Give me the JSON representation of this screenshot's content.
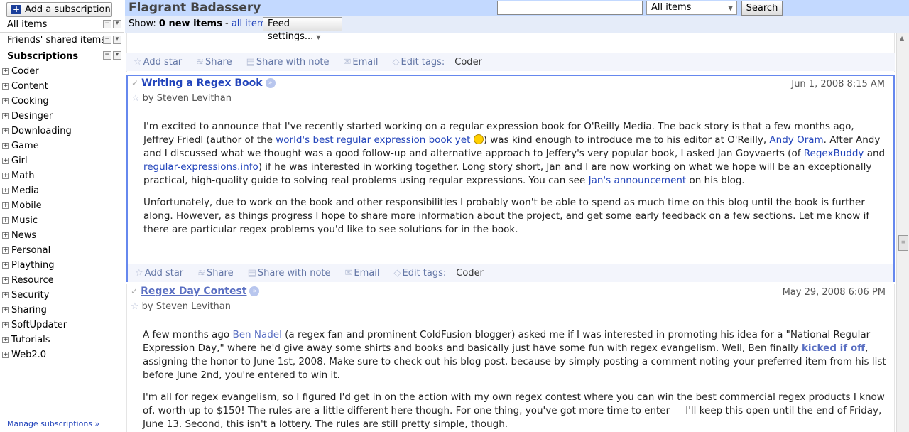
{
  "sidebar": {
    "add_subscription": "Add a subscription",
    "all_items": "All items",
    "friends_shared": "Friends' shared items",
    "subscriptions": "Subscriptions",
    "folders": [
      "Coder",
      "Content",
      "Cooking",
      "Desinger",
      "Downloading",
      "Game",
      "Girl",
      "Math",
      "Media",
      "Mobile",
      "Music",
      "News",
      "Personal",
      "Plaything",
      "Resource",
      "Security",
      "Sharing",
      "SoftUpdater",
      "Tutorials",
      "Web2.0"
    ],
    "manage": "Manage subscriptions »"
  },
  "header": {
    "feed_title": "Flagrant Badassery",
    "search_scope": "All items",
    "search_button": "Search"
  },
  "viewbar": {
    "show_label": "Show:",
    "new_items": "0 new items",
    "separator": "-",
    "all_items_link": "all items",
    "feed_settings": "Feed settings..."
  },
  "actions": {
    "add_star": "Add star",
    "share": "Share",
    "share_note": "Share with note",
    "email": "Email",
    "edit_tags": "Edit tags:",
    "tag": "Coder"
  },
  "entries": [
    {
      "title": "Writing a Regex Book",
      "date": "Jun 1, 2008 8:15 AM",
      "author": "by Steven Levithan",
      "p1_a": "I'm excited to announce that I've recently started working on a regular expression book for O'Reilly Media. The back story is that a few months ago, Jeffrey Friedl (author of the ",
      "p1_link1": "world's best regular expression book yet",
      "p1_b": ") was kind enough to introduce me to his editor at O'Reilly, ",
      "p1_link2": "Andy Oram",
      "p1_c": ". After Andy and I discussed what we thought was a good follow-up and alternative approach to Jeffery's very popular book, I asked Jan Goyvaerts (of ",
      "p1_link3": "RegexBuddy",
      "p1_d": " and ",
      "p1_link4": "regular-expressions.info",
      "p1_e": ") if he was interested in working together. Long story short, Jan and I are now working on what we hope will be an exceptionally practical, high-quality guide to solving real problems using regular expressions. You can see ",
      "p1_link5": "Jan's announcement",
      "p1_f": " on his blog.",
      "p2": "Unfortunately, due to work on the book and other responsibilities I probably won't be able to spend as much time on this blog until the book is further along. However, as things progress I hope to share more information about the project, and get some early feedback on a few sections. Let me know if there are particular regex problems you'd like to see solutions for in the book."
    },
    {
      "title": "Regex Day Contest",
      "date": "May 29, 2008 6:06 PM",
      "author": "by Steven Levithan",
      "p1_a": "A few months ago ",
      "p1_link1": "Ben Nadel",
      "p1_b": " (a regex fan and prominent ColdFusion blogger) asked me if I was interested in promoting his idea for a \"National Regular Expression Day,\" where he'd give away some shirts and books and basically just have some fun with regex evangelism. Well, Ben finally ",
      "p1_link2": "kicked if off",
      "p1_c": ", assigning the honor to June 1st, 2008. Make sure to check out his blog post, because by simply posting a comment noting your preferred item from his list before June 2nd, you're entered to win it.",
      "p2": "I'm all for regex evangelism, so I figured I'd get in on the action with my own regex contest where you can win the best commercial regex products I know of, worth up to $150! The rules are a little different here though. For one thing, you've got more time to enter — I'll keep this open until the end of Friday, June 13. Second, this isn't a lottery. The rules are still pretty simple, though."
    }
  ]
}
